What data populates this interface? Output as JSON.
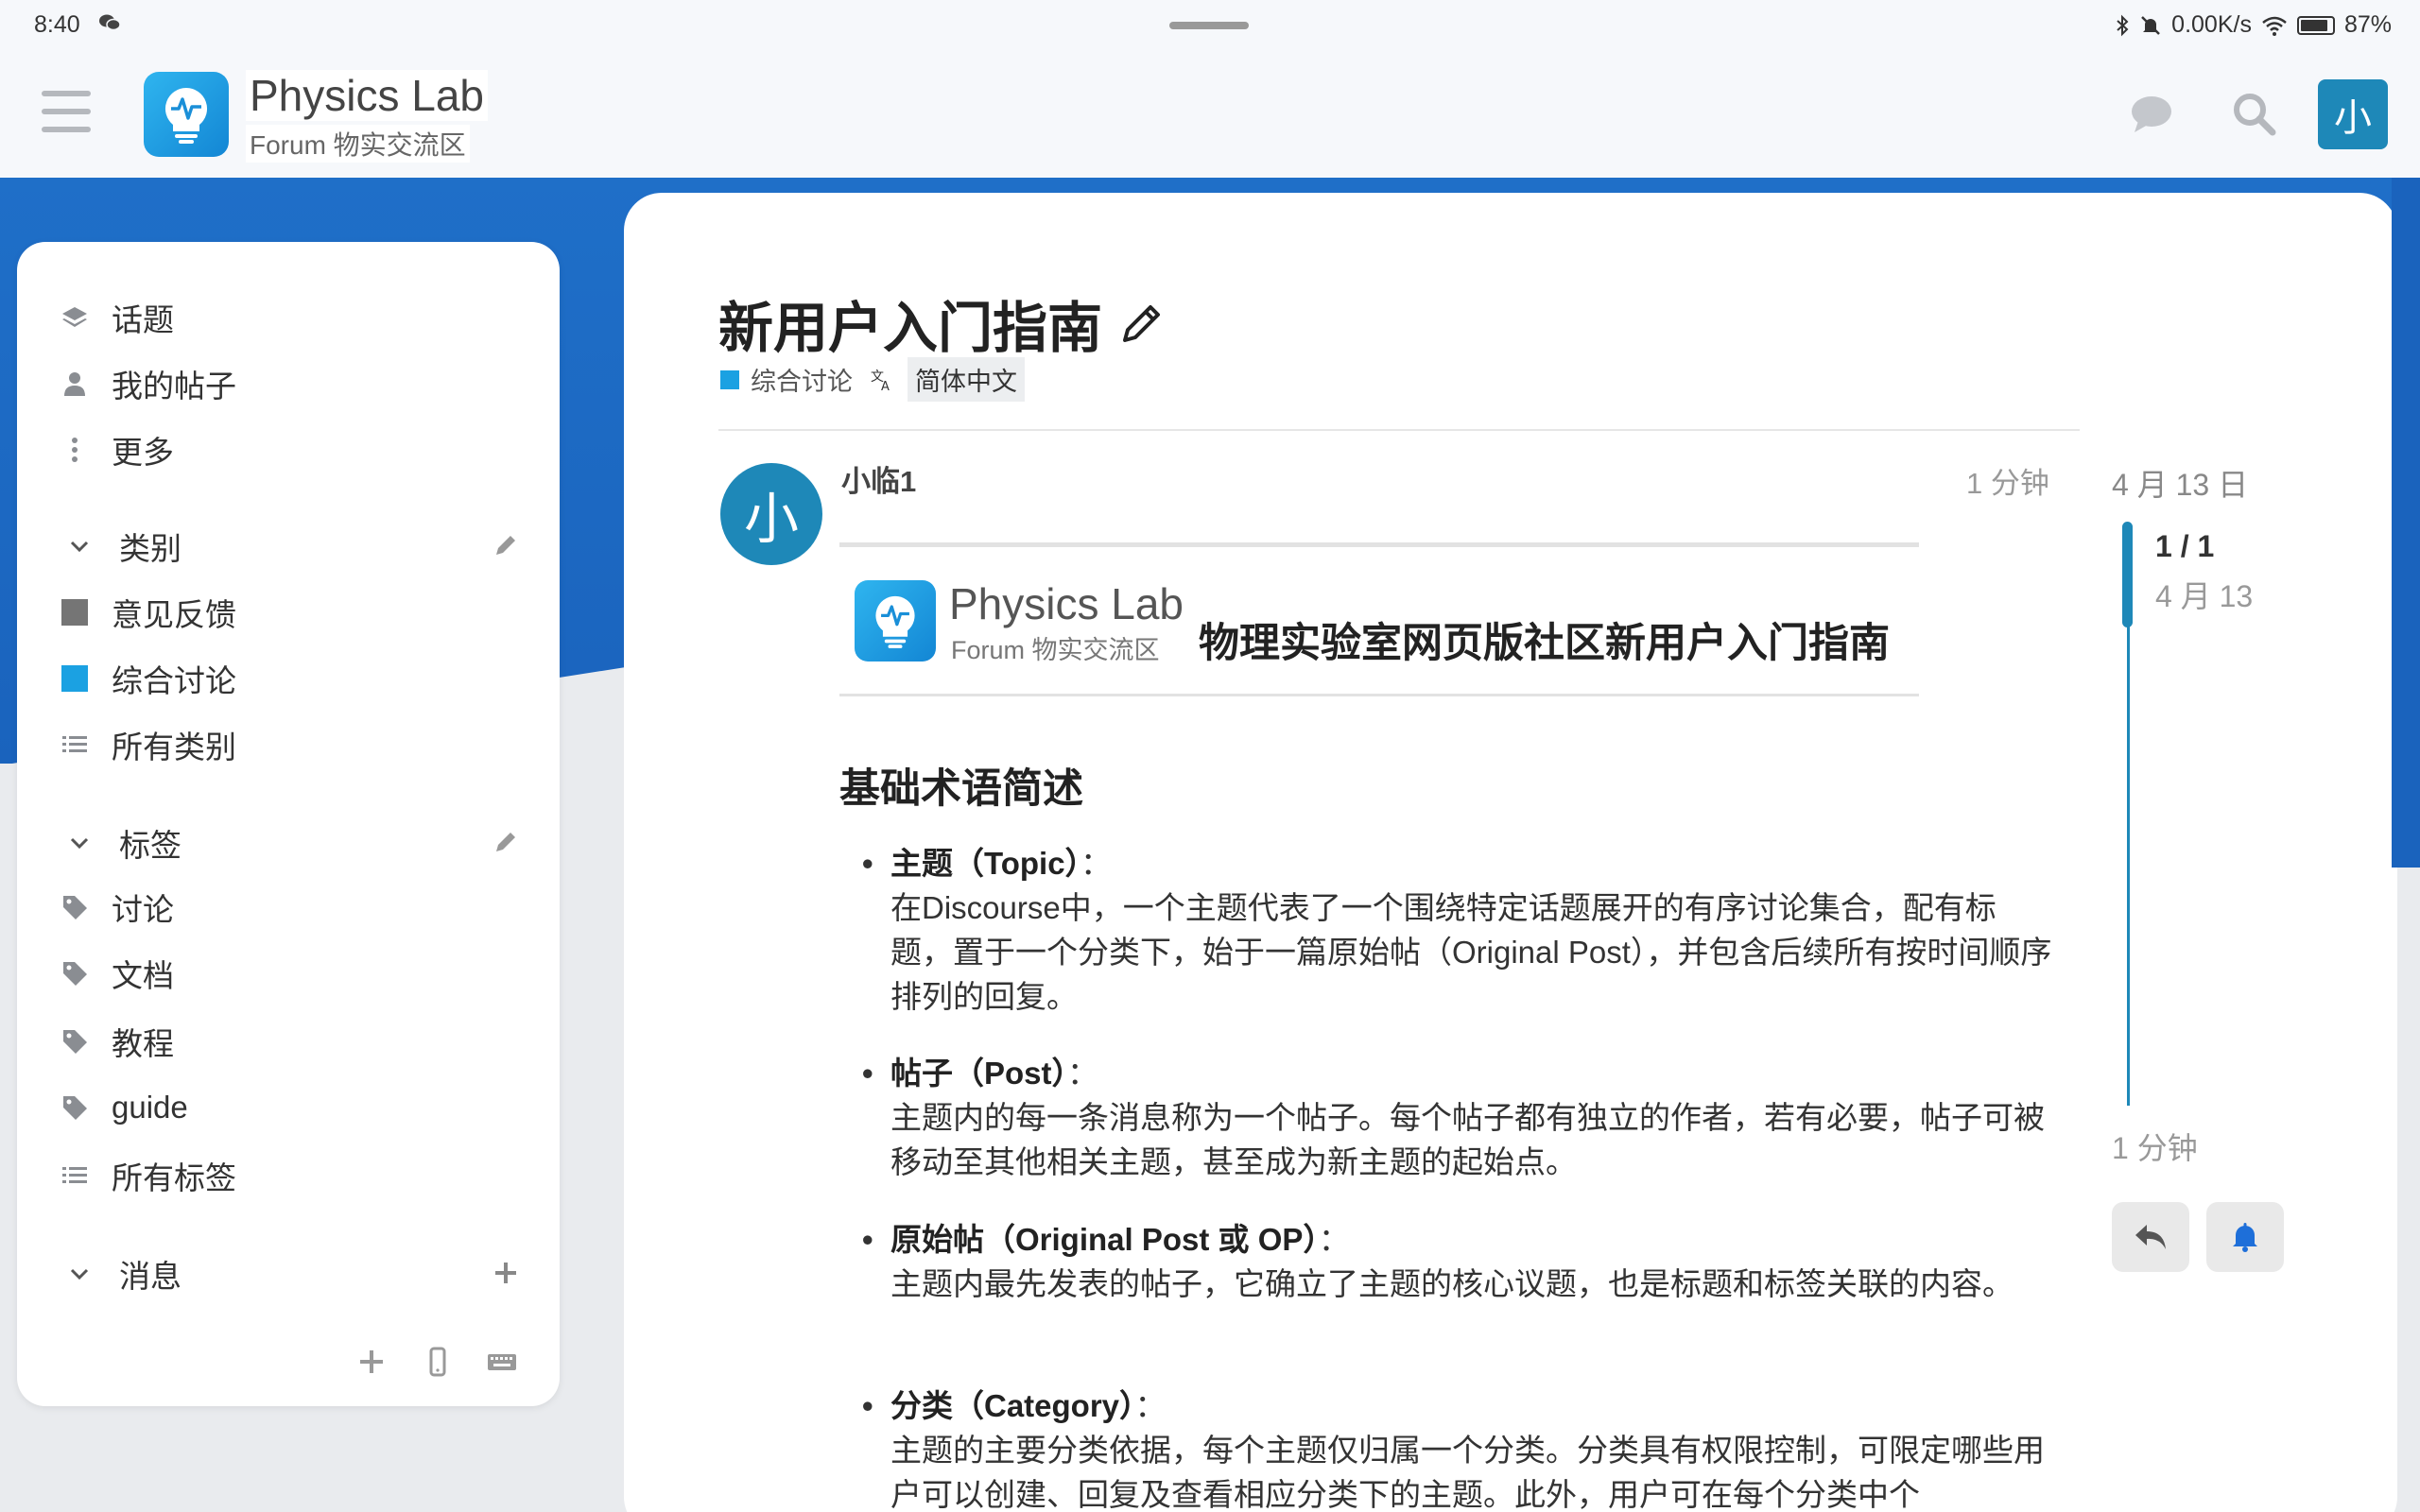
{
  "status_bar": {
    "time": "8:40",
    "network_speed": "0.00K/s",
    "battery": "87%",
    "icons": [
      "wechat-icon",
      "bluetooth-icon",
      "mute-icon",
      "wifi-icon",
      "battery-icon"
    ]
  },
  "header": {
    "logo_title": "Physics Lab",
    "logo_subtitle": "Forum 物实交流区",
    "avatar_letter": "小",
    "icons": [
      "menu-icon",
      "chat-icon",
      "search-icon"
    ]
  },
  "sidebar": {
    "items": [
      {
        "label": "话题",
        "icon": "layers-icon"
      },
      {
        "label": "我的帖子",
        "icon": "user-icon"
      },
      {
        "label": "更多",
        "icon": "more-vertical-icon"
      }
    ],
    "categories_section": "类别",
    "categories": [
      {
        "label": "意见反馈",
        "color": "#757575"
      },
      {
        "label": "综合讨论",
        "color": "#1ba1e2"
      },
      {
        "label": "所有类别",
        "icon": "list-icon"
      }
    ],
    "tags_section": "标签",
    "tags": [
      {
        "label": "讨论",
        "icon": "tag-icon"
      },
      {
        "label": "文档",
        "icon": "tag-icon"
      },
      {
        "label": "教程",
        "icon": "tag-icon"
      },
      {
        "label": "guide",
        "icon": "tag-icon"
      },
      {
        "label": "所有标签",
        "icon": "list-icon"
      }
    ],
    "messages_section": "消息"
  },
  "topic": {
    "title": "新用户入门指南",
    "category": "综合讨论",
    "category_color": "#1ba1e2",
    "language": "简体中文"
  },
  "post": {
    "avatar_letter": "小",
    "username": "小临1",
    "time": "1 分钟",
    "banner_title": "Physics Lab",
    "banner_subtitle": "Forum 物实交流区",
    "banner_heading": "物理实验室网页版社区新用户入门指南",
    "section_heading": "基础术语简述",
    "terms": [
      {
        "name": "主题（Topic）",
        "colon": "：",
        "desc": "在Discourse中，一个主题代表了一个围绕特定话题展开的有序讨论集合，配有标题，置于一个分类下，始于一篇原始帖（Original Post），并包含后续所有按时间顺序排列的回复。"
      },
      {
        "name": "帖子（Post）",
        "colon": "：",
        "desc": "主题内的每一条消息称为一个帖子。每个帖子都有独立的作者，若有必要，帖子可被移动至其他相关主题，甚至成为新主题的起始点。"
      },
      {
        "name": "原始帖（Original Post 或 OP）",
        "colon": "：",
        "desc": "主题内最先发表的帖子，它确立了主题的核心议题，也是标题和标签关联的内容。"
      },
      {
        "name": "分类（Category）",
        "colon": "：",
        "desc": "主题的主要分类依据，每个主题仅归属一个分类。分类具有权限控制，可限定哪些用户可以创建、回复及查看相应分类下的主题。此外，用户可在每个分类中个"
      }
    ]
  },
  "timeline": {
    "top_date": "4 月 13 日",
    "position": "1 / 1",
    "position_date": "4 月 13",
    "bottom_label": "1 分钟"
  }
}
